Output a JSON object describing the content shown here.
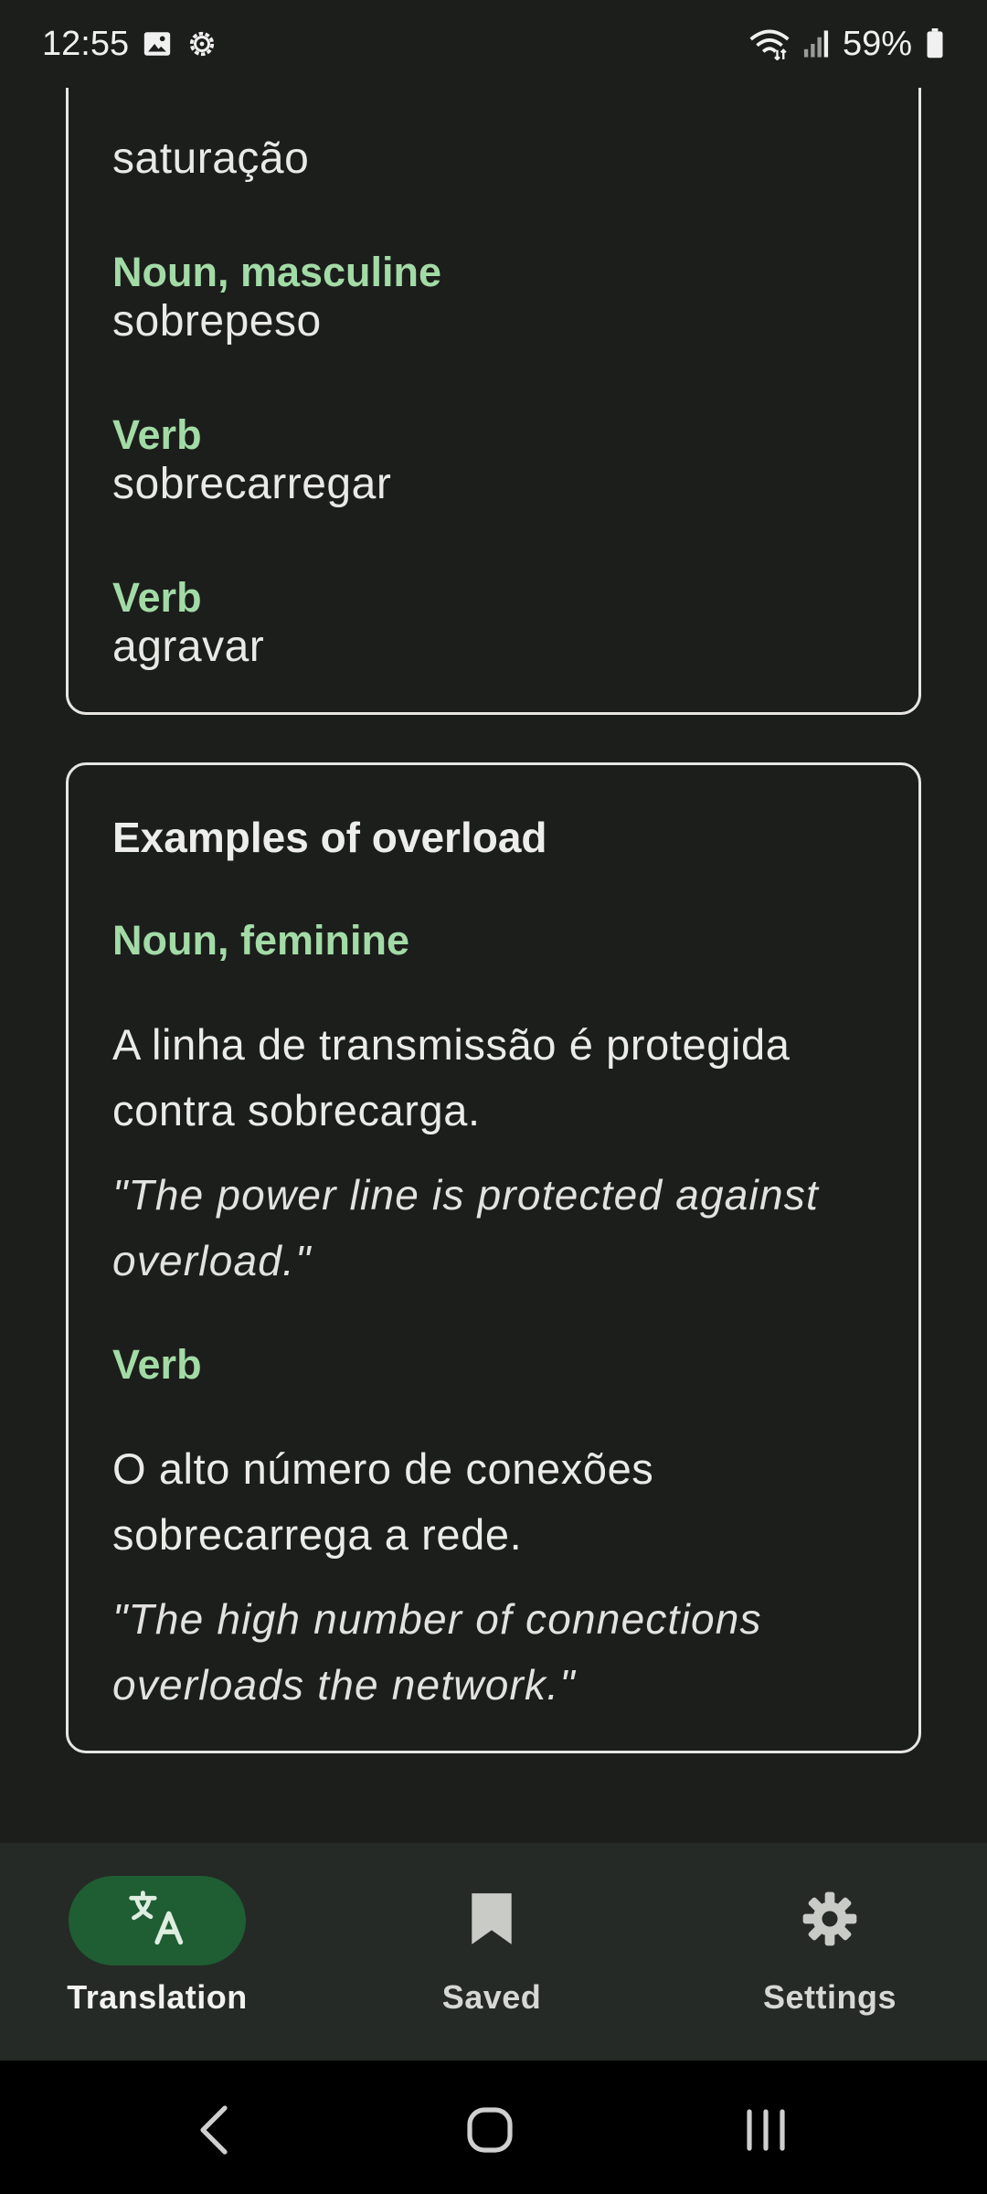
{
  "status_bar": {
    "time": "12:55",
    "battery": "59%",
    "icons": [
      "image-icon",
      "gear-outline-icon",
      "wifi-icon",
      "signal-icon",
      "battery-icon"
    ]
  },
  "translations_card": {
    "entries": [
      {
        "pos": "",
        "word": "saturação"
      },
      {
        "pos": "Noun, masculine",
        "word": "sobrepeso"
      },
      {
        "pos": "Verb",
        "word": "sobrecarregar"
      },
      {
        "pos": "Verb",
        "word": "agravar"
      }
    ]
  },
  "examples_card": {
    "title_prefix": "Examples of ",
    "title_word": "overload",
    "groups": [
      {
        "pos": "Noun, feminine",
        "sentence": "A linha de transmissão é protegida contra sobrecarga.",
        "translation": "\"The power line is protected against overload.\""
      },
      {
        "pos": "Verb",
        "sentence": "O alto número de conexões sobrecarrega a rede.",
        "translation": "\"The high number of connections overloads the network.\""
      }
    ]
  },
  "bottom_nav": {
    "items": [
      {
        "label": "Translation",
        "icon": "translate-icon",
        "active": true
      },
      {
        "label": "Saved",
        "icon": "bookmark-icon",
        "active": false
      },
      {
        "label": "Settings",
        "icon": "settings-gear-icon",
        "active": false
      }
    ]
  },
  "colors": {
    "background": "#1c1e1c",
    "accent_green": "#a3dba6",
    "active_pill": "#1f5d33",
    "nav_background": "#252a26"
  }
}
